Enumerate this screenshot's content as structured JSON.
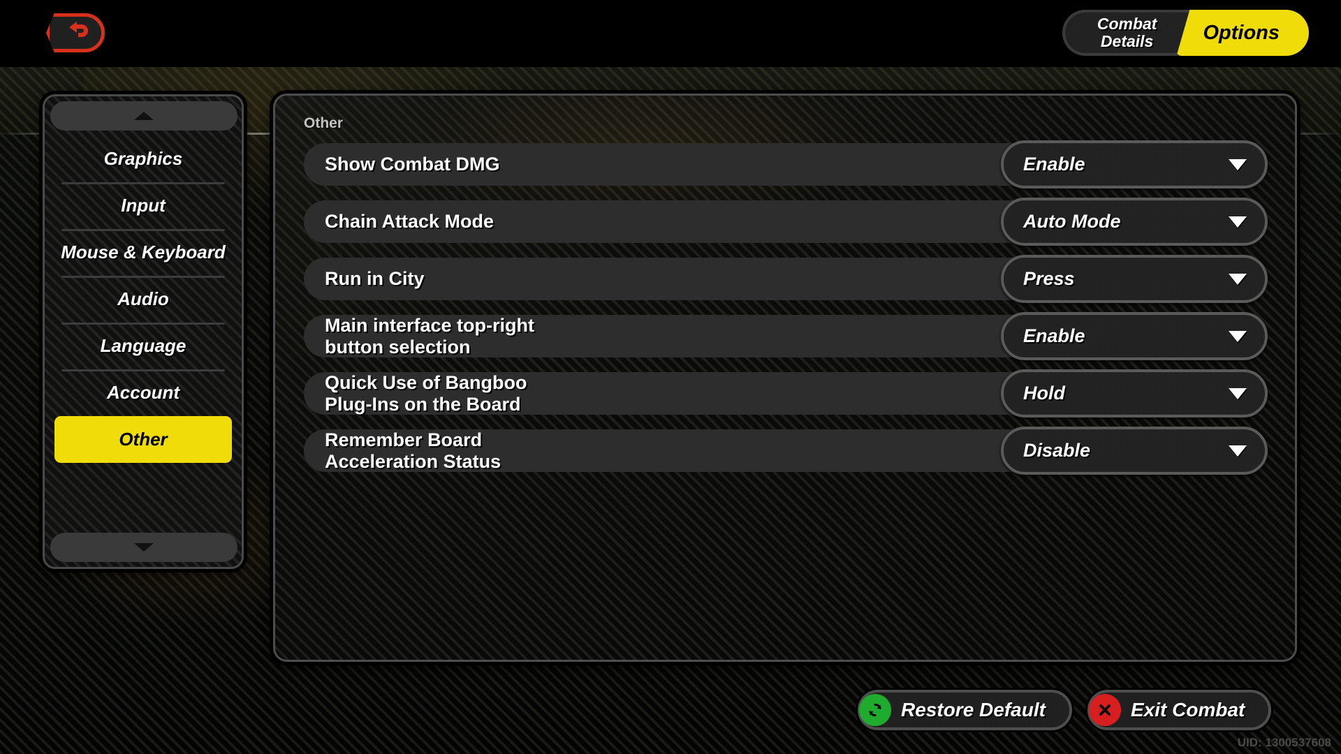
{
  "header": {
    "back_icon": "back-arrow-icon",
    "tabs": [
      {
        "label_line1": "Combat",
        "label_line2": "Details",
        "active": false
      },
      {
        "label": "Options",
        "active": true
      }
    ]
  },
  "sidebar": {
    "scroll_up_icon": "caret-up-icon",
    "scroll_down_icon": "caret-down-icon",
    "items": [
      {
        "label": "Graphics",
        "active": false
      },
      {
        "label": "Input",
        "active": false
      },
      {
        "label": "Mouse & Keyboard",
        "active": false
      },
      {
        "label": "Audio",
        "active": false
      },
      {
        "label": "Language",
        "active": false
      },
      {
        "label": "Account",
        "active": false
      },
      {
        "label": "Other",
        "active": true
      }
    ]
  },
  "main": {
    "section_title": "Other",
    "rows": [
      {
        "label_line1": "Show Combat DMG",
        "label_line2": "",
        "value": "Enable"
      },
      {
        "label_line1": "Chain Attack Mode",
        "label_line2": "",
        "value": "Auto Mode"
      },
      {
        "label_line1": "Run in City",
        "label_line2": "",
        "value": "Press"
      },
      {
        "label_line1": "Main interface top-right",
        "label_line2": "button selection",
        "value": "Enable"
      },
      {
        "label_line1": "Quick Use of Bangboo",
        "label_line2": "Plug-Ins on the Board",
        "value": "Hold"
      },
      {
        "label_line1": "Remember Board",
        "label_line2": "Acceleration Status",
        "value": "Disable"
      }
    ],
    "dropdown_caret_icon": "caret-down-icon"
  },
  "footer": {
    "restore_default_label": "Restore Default",
    "restore_default_icon": "refresh-icon",
    "exit_combat_label": "Exit Combat",
    "exit_combat_icon": "close-x-icon",
    "uid": "UID: 1300537608"
  },
  "colors": {
    "accent_yellow": "#efdc08",
    "back_red": "#d8301a",
    "restore_green": "#1fab2d",
    "exit_red": "#d81f1f"
  }
}
